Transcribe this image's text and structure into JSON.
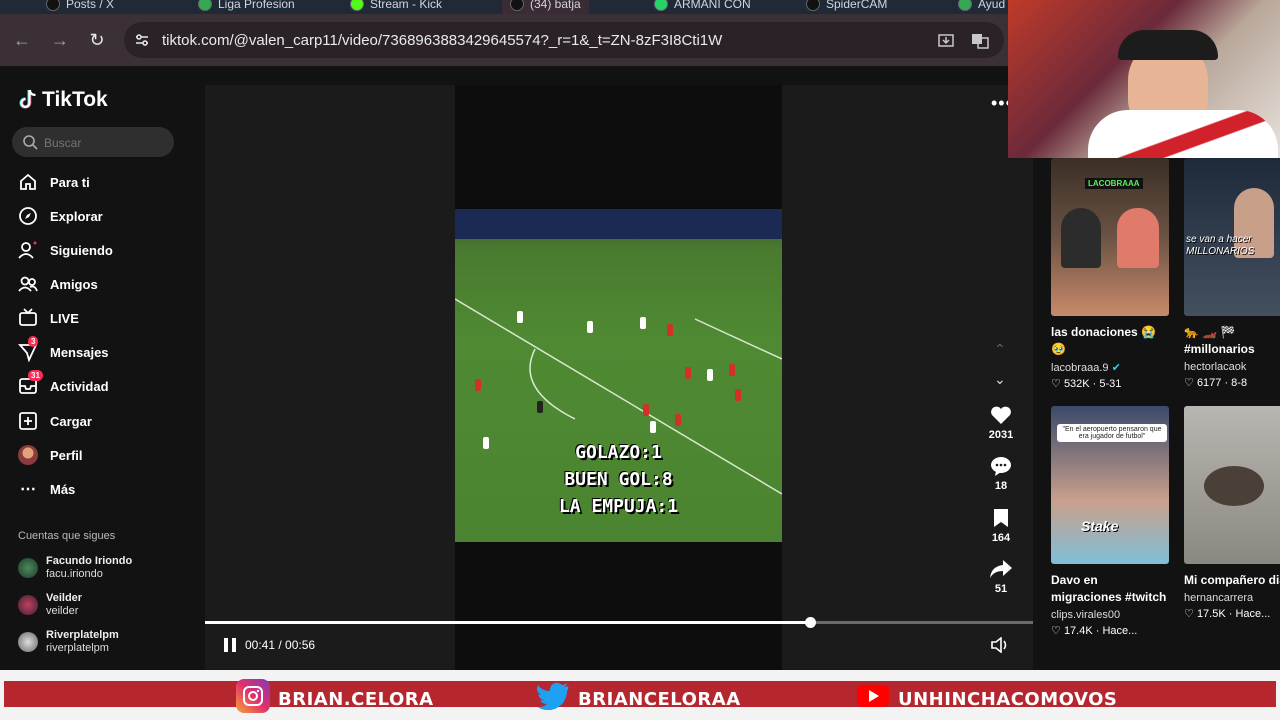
{
  "browser": {
    "tabs": [
      {
        "label": "Posts / X",
        "favicon_color": "#111111"
      },
      {
        "label": "Liga Profesion",
        "favicon_color": "#34a853"
      },
      {
        "label": "Stream - Kick",
        "favicon_color": "#53fc18"
      },
      {
        "label": "(34) batja",
        "favicon_color": "#111111",
        "active": true
      },
      {
        "label": "ARMANI CON",
        "favicon_color": "#25d366"
      },
      {
        "label": "SpiderCAM",
        "favicon_color": "#111111"
      },
      {
        "label": "Ayud",
        "favicon_color": "#34a853"
      }
    ],
    "url": "tiktok.com/@valen_carp11/video/7368963883429645574?_r=1&_t=ZN-8zF3I8Cti1W"
  },
  "tiktok": {
    "logo_text": "TikTok",
    "search_placeholder": "Buscar",
    "nav": [
      {
        "label": "Para ti",
        "icon": "home-icon"
      },
      {
        "label": "Explorar",
        "icon": "compass-icon"
      },
      {
        "label": "Siguiendo",
        "icon": "following-icon"
      },
      {
        "label": "Amigos",
        "icon": "friends-icon"
      },
      {
        "label": "LIVE",
        "icon": "live-icon"
      },
      {
        "label": "Mensajes",
        "icon": "messages-icon",
        "badge": "3"
      },
      {
        "label": "Actividad",
        "icon": "activity-icon",
        "badge": "31"
      },
      {
        "label": "Cargar",
        "icon": "upload-icon"
      },
      {
        "label": "Perfil",
        "icon": "profile-icon"
      },
      {
        "label": "Más",
        "icon": "more-icon"
      }
    ],
    "following_title": "Cuentas que sigues",
    "following": [
      {
        "name": "Facundo Iriondo",
        "handle": "facu.iriondo"
      },
      {
        "name": "Veilder",
        "handle": "veilder"
      },
      {
        "name": "Riverplatelpm",
        "handle": "riverplatelpm"
      }
    ]
  },
  "video": {
    "overlay": [
      "GOLAZO:1",
      "BUEN GOL:8",
      "LA EMPUJA:1"
    ],
    "time": "00:41 / 00:56",
    "progress": 0.731,
    "actions": {
      "likes": "2031",
      "comments": "18",
      "saves": "164",
      "shares": "51"
    }
  },
  "recommended": [
    {
      "title": "las donaciones 😭 🥹",
      "author": "lacobraaa.9",
      "verified": true,
      "stats": "532K · 5-31",
      "thumb_text": "LACOBRAAA"
    },
    {
      "title": "🐆 🏎️ 🏁 #millonarios #motivacion #fyp",
      "author": "hectorlacaok",
      "stats": "6177 · 8-8",
      "thumb_text": "se van a hacer MILLONARIOS"
    },
    {
      "title": "Davo en migraciones #twitch #kick...",
      "author": "clips.virales00",
      "stats": "17.4K · Hace...",
      "thumb_text": "\"En el aeropuerto pensaron que era jugador de futbol\""
    },
    {
      "title": "Mi compañero dia",
      "author": "hernancarrera",
      "stats": "17.5K · Hace..."
    }
  ],
  "banner": {
    "instagram": "BRIAN.CELORA",
    "twitter": "BRIANCELORAA",
    "youtube": "UNHINCHACOMOVOS"
  }
}
